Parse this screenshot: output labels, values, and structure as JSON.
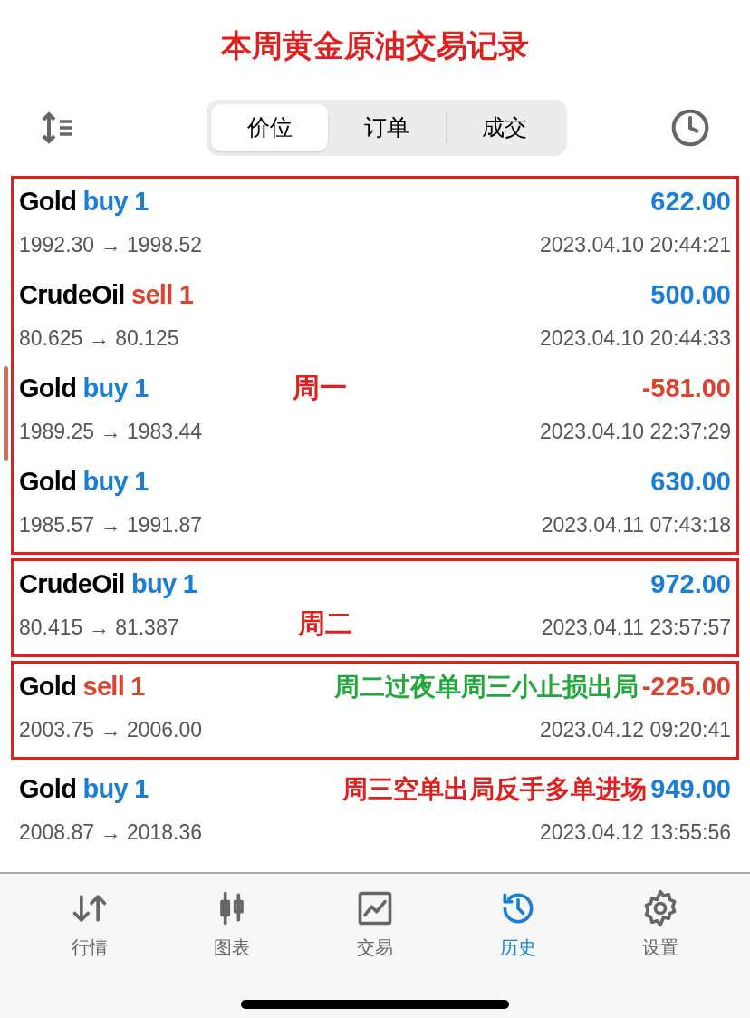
{
  "title": "本周黄金原油交易记录",
  "tabs": [
    {
      "label": "价位",
      "selected": true
    },
    {
      "label": "订单",
      "selected": false
    },
    {
      "label": "成交",
      "selected": false
    }
  ],
  "groups": [
    {
      "boxed": true,
      "note": {
        "text": "周一",
        "color": "#e0201e",
        "kind": "center"
      },
      "trades": [
        {
          "symbol": "Gold",
          "kind": "buy",
          "side_text": "buy 1",
          "profit": "622.00",
          "loss": false,
          "prices": "1992.30 → 1998.52",
          "time": "2023.04.10 20:44:21"
        },
        {
          "symbol": "CrudeOil",
          "kind": "sell",
          "side_text": "sell 1",
          "profit": "500.00",
          "loss": false,
          "prices": "80.625 → 80.125",
          "time": "2023.04.10 20:44:33"
        },
        {
          "symbol": "Gold",
          "kind": "buy",
          "side_text": "buy 1",
          "profit": "-581.00",
          "loss": true,
          "prices": "1989.25 → 1983.44",
          "time": "2023.04.10 22:37:29"
        },
        {
          "symbol": "Gold",
          "kind": "buy",
          "side_text": "buy 1",
          "profit": "630.00",
          "loss": false,
          "prices": "1985.57 → 1991.87",
          "time": "2023.04.11 07:43:18"
        }
      ]
    },
    {
      "boxed": true,
      "note": {
        "text": "周二",
        "color": "#e0201e",
        "kind": "lower"
      },
      "trades": [
        {
          "symbol": "CrudeOil",
          "kind": "buy",
          "side_text": "buy 1",
          "profit": "972.00",
          "loss": false,
          "prices": "80.415 → 81.387",
          "time": "2023.04.11 23:57:57"
        }
      ]
    },
    {
      "boxed": true,
      "note": {
        "text": "周二过夜单周三小止损出局",
        "color": "#22a83a",
        "kind": "inline"
      },
      "trades": [
        {
          "symbol": "Gold",
          "kind": "sell",
          "side_text": "sell 1",
          "profit": "-225.00",
          "loss": true,
          "prices": "2003.75 → 2006.00",
          "time": "2023.04.12 09:20:41"
        }
      ]
    },
    {
      "boxed": false,
      "note": {
        "text": "周三空单出局反手多单进场",
        "color": "#e0201e",
        "kind": "inline"
      },
      "trades": [
        {
          "symbol": "Gold",
          "kind": "buy",
          "side_text": "buy 1",
          "profit": "949.00",
          "loss": false,
          "prices": "2008.87 → 2018.36",
          "time": "2023.04.12 13:55:56"
        }
      ]
    }
  ],
  "nav": [
    {
      "label": "行情",
      "selected": false
    },
    {
      "label": "图表",
      "selected": false
    },
    {
      "label": "交易",
      "selected": false
    },
    {
      "label": "历史",
      "selected": true
    },
    {
      "label": "设置",
      "selected": false
    }
  ]
}
